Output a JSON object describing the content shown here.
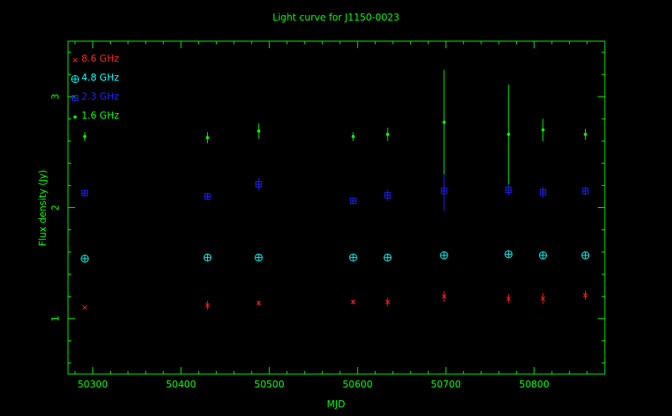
{
  "chart_data": {
    "type": "scatter",
    "title": "Light curve for J1150-0023",
    "xlabel": "MJD",
    "ylabel": "Flux density (Jy)",
    "xlim": [
      50272,
      50880
    ],
    "ylim": [
      0.5,
      3.5
    ],
    "x_ticks": [
      50300,
      50400,
      50500,
      50600,
      50700,
      50800
    ],
    "y_ticks": [
      1,
      2,
      3
    ],
    "legend_position": "top-left",
    "colors": {
      "background": "#000000",
      "axes": "#00ff00",
      "text": "#00ff00"
    },
    "series": [
      {
        "name": "8.6 GHz",
        "marker": "x",
        "color": "#ff2020",
        "points": [
          {
            "x": 50291,
            "y": 1.1,
            "err": 0.0
          },
          {
            "x": 50430,
            "y": 1.12,
            "err": 0.04
          },
          {
            "x": 50488,
            "y": 1.14,
            "err": 0.02
          },
          {
            "x": 50595,
            "y": 1.15,
            "err": 0.02
          },
          {
            "x": 50634,
            "y": 1.15,
            "err": 0.04
          },
          {
            "x": 50698,
            "y": 1.2,
            "err": 0.05
          },
          {
            "x": 50771,
            "y": 1.18,
            "err": 0.04
          },
          {
            "x": 50810,
            "y": 1.18,
            "err": 0.05
          },
          {
            "x": 50858,
            "y": 1.21,
            "err": 0.04
          }
        ]
      },
      {
        "name": "4.8 GHz",
        "marker": "circle-plus",
        "color": "#00ffff",
        "points": [
          {
            "x": 50291,
            "y": 1.54,
            "err": 0.0
          },
          {
            "x": 50430,
            "y": 1.55,
            "err": 0.0
          },
          {
            "x": 50488,
            "y": 1.55,
            "err": 0.0
          },
          {
            "x": 50595,
            "y": 1.55,
            "err": 0.0
          },
          {
            "x": 50634,
            "y": 1.55,
            "err": 0.0
          },
          {
            "x": 50698,
            "y": 1.57,
            "err": 0.0
          },
          {
            "x": 50771,
            "y": 1.58,
            "err": 0.0
          },
          {
            "x": 50810,
            "y": 1.57,
            "err": 0.0
          },
          {
            "x": 50858,
            "y": 1.57,
            "err": 0.0
          }
        ]
      },
      {
        "name": "2.3 GHz",
        "marker": "square-plus",
        "color": "#2020ff",
        "points": [
          {
            "x": 50291,
            "y": 2.13,
            "err": 0.03
          },
          {
            "x": 50430,
            "y": 2.1,
            "err": 0.03
          },
          {
            "x": 50488,
            "y": 2.21,
            "err": 0.06
          },
          {
            "x": 50595,
            "y": 2.06,
            "err": 0.03
          },
          {
            "x": 50634,
            "y": 2.11,
            "err": 0.05
          },
          {
            "x": 50698,
            "y": 2.15,
            "err": 0.18
          },
          {
            "x": 50771,
            "y": 2.16,
            "err": 0.05
          },
          {
            "x": 50810,
            "y": 2.14,
            "err": 0.05
          },
          {
            "x": 50858,
            "y": 2.15,
            "err": 0.04
          }
        ]
      },
      {
        "name": "1.6 GHz",
        "marker": "dot",
        "color": "#00ff00",
        "points": [
          {
            "x": 50291,
            "y": 2.64,
            "err": 0.04
          },
          {
            "x": 50430,
            "y": 2.63,
            "err": 0.05
          },
          {
            "x": 50488,
            "y": 2.69,
            "err": 0.07
          },
          {
            "x": 50595,
            "y": 2.64,
            "err": 0.04
          },
          {
            "x": 50634,
            "y": 2.66,
            "err": 0.06
          },
          {
            "x": 50698,
            "y": 2.77,
            "err": 0.47
          },
          {
            "x": 50771,
            "y": 2.66,
            "err": 0.45
          },
          {
            "x": 50810,
            "y": 2.7,
            "err": 0.1
          },
          {
            "x": 50858,
            "y": 2.66,
            "err": 0.05
          }
        ]
      }
    ]
  }
}
